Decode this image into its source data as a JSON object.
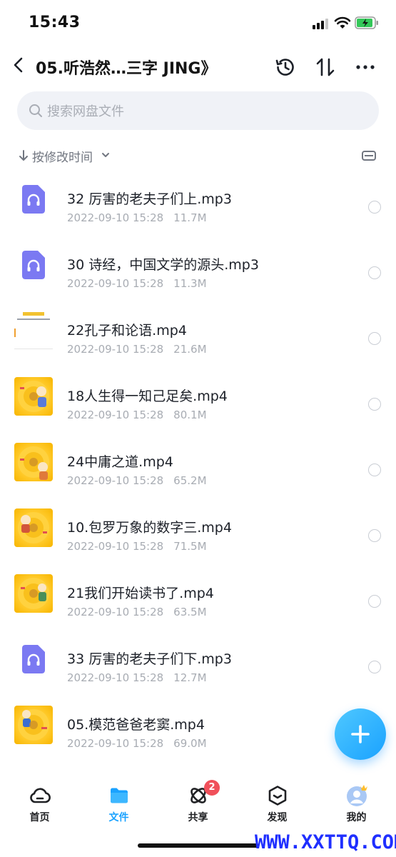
{
  "status_bar": {
    "time": "15:43"
  },
  "header": {
    "title": "05.听浩然…三字 JING》"
  },
  "search": {
    "placeholder": "搜索网盘文件"
  },
  "sort": {
    "label": "按修改时间"
  },
  "files": [
    {
      "name": "32 厉害的老夫子们上.mp3",
      "date": "2022-09-10 15:28",
      "size": "11.7M",
      "type": "audio"
    },
    {
      "name": "30 诗经，中国文学的源头.mp3",
      "date": "2022-09-10 15:28",
      "size": "11.3M",
      "type": "audio"
    },
    {
      "name": "22孔子和论语.mp4",
      "date": "2022-09-10 15:28",
      "size": "21.6M",
      "type": "document"
    },
    {
      "name": "18人生得一知己足矣.mp4",
      "date": "2022-09-10 15:28",
      "size": "80.1M",
      "type": "video"
    },
    {
      "name": "24中庸之道.mp4",
      "date": "2022-09-10 15:28",
      "size": "65.2M",
      "type": "video"
    },
    {
      "name": "10.包罗万象的数字三.mp4",
      "date": "2022-09-10 15:28",
      "size": "71.5M",
      "type": "video"
    },
    {
      "name": "21我们开始读书了.mp4",
      "date": "2022-09-10 15:28",
      "size": "63.5M",
      "type": "video"
    },
    {
      "name": "33 厉害的老夫子们下.mp3",
      "date": "2022-09-10 15:28",
      "size": "12.7M",
      "type": "audio"
    },
    {
      "name": "05.模范爸爸老窦.mp4",
      "date": "2022-09-10 15:28",
      "size": "69.0M",
      "type": "video"
    }
  ],
  "tabs": [
    {
      "label": "首页",
      "icon": "cloud-home-icon",
      "active": false
    },
    {
      "label": "文件",
      "icon": "folder-icon",
      "active": true
    },
    {
      "label": "共享",
      "icon": "share-orbit-icon",
      "active": false,
      "badge": "2"
    },
    {
      "label": "发现",
      "icon": "discover-cube-icon",
      "active": false
    },
    {
      "label": "我的",
      "icon": "avatar-icon",
      "active": false
    }
  ],
  "watermark": "WWW.XXTTQ.COM",
  "colors": {
    "accent": "#1aa2ff",
    "badge": "#f0505a",
    "audio_icon": "#7b79f2",
    "video_thumb": "#ffc928"
  }
}
